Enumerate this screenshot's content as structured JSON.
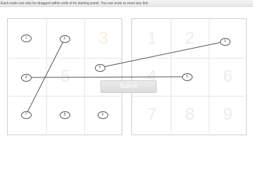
{
  "instruction": "Each node can only be dragged within cells of its starting panel. You can undo or reset any link.",
  "submit_label": "Submit",
  "left_panel": {
    "digits": [
      "",
      "",
      "3",
      "",
      "5",
      "",
      "",
      "",
      ""
    ],
    "nodes": [
      {
        "cell": 0,
        "label": "1"
      },
      {
        "cell": 1,
        "label": "2"
      },
      {
        "cell": 3,
        "label": "4"
      },
      {
        "cell": 4,
        "label": "5"
      },
      {
        "cell": 6,
        "label": "7"
      },
      {
        "cell": 7,
        "label": "8"
      },
      {
        "cell": 8,
        "label": "9"
      }
    ]
  },
  "right_panel": {
    "digits": [
      "1",
      "2",
      "",
      "4",
      "",
      "6",
      "7",
      "8",
      "9"
    ],
    "nodes": [
      {
        "cell": 2,
        "label": "3"
      },
      {
        "cell": 4,
        "label": "5"
      }
    ]
  },
  "links": [
    {
      "from": "L2",
      "to": "L7"
    },
    {
      "from": "L4",
      "to": "R5"
    },
    {
      "from": "L5",
      "to": "R3"
    }
  ]
}
